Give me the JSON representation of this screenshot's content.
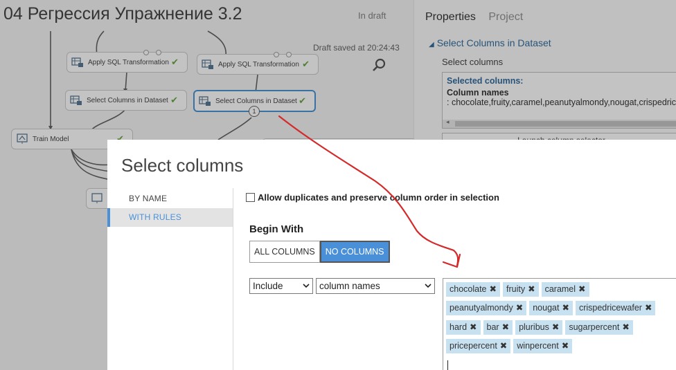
{
  "experiment": {
    "title": "04 Регрессия Упражнение 3.2",
    "status": "In draft",
    "saved": "Draft saved at 20:24:43"
  },
  "nodes": {
    "apply_sql_1": "Apply SQL Transformation",
    "apply_sql_2": "Apply SQL Transformation",
    "select_cols_1": "Select Columns in Dataset",
    "select_cols_2": "Select Columns in Dataset",
    "port_number": "1",
    "train_model": "Train Model"
  },
  "properties": {
    "tabs": [
      "Properties",
      "Project"
    ],
    "module_title": "Select Columns in Dataset",
    "select_label": "Select columns",
    "selected_heading": "Selected columns:",
    "column_names_label": "Column names",
    "column_names_value": ": chocolate,fruity,caramel,peanutyalmondy,nougat,crispedricewafer",
    "launch": "Launch column selector"
  },
  "modal": {
    "title": "Select columns",
    "nav": [
      "BY NAME",
      "WITH RULES"
    ],
    "allow_label": "Allow duplicates and preserve column order in selection",
    "begin_with": "Begin With",
    "all_columns": "ALL COLUMNS",
    "no_columns": "NO COLUMNS",
    "include_value": "Include",
    "mode_value": "column names",
    "tags": [
      [
        "chocolate",
        "fruity",
        "caramel"
      ],
      [
        "peanutyalmondy",
        "nougat",
        "crispedricewafer"
      ],
      [
        "hard",
        "bar",
        "pluribus",
        "sugarpercent"
      ],
      [
        "pricepercent",
        "winpercent"
      ]
    ]
  },
  "colors": {
    "accent": "#4a90d9",
    "tag_bg": "#c7e1f1",
    "annotation": "#d42a2a",
    "check": "#5a9e2f"
  }
}
